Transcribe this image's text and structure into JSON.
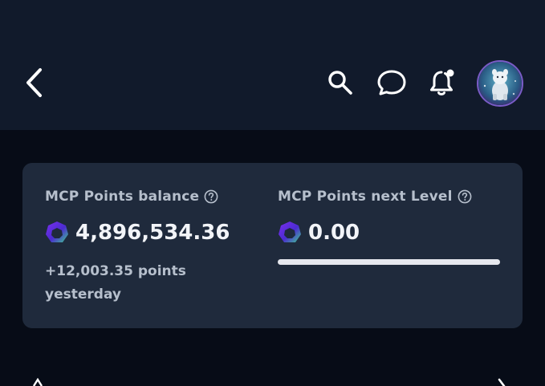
{
  "header": {
    "back_icon": "chevron-left-icon",
    "actions": [
      "search-icon",
      "chat-icon",
      "bell-icon"
    ],
    "avatar": "user-avatar"
  },
  "balance": {
    "label": "MCP Points balance",
    "value": "4,896,534.36",
    "delta": "+12,003.35 points yesterday"
  },
  "next_level": {
    "label": "MCP Points next Level",
    "value": "0.00",
    "progress": 1.0
  },
  "colors": {
    "header_bg": "#111a2b",
    "page_bg": "#070c17",
    "card_bg": "#1f2a3c",
    "coin_purple": "#6a2fd6",
    "coin_green": "#3fcf8e"
  }
}
